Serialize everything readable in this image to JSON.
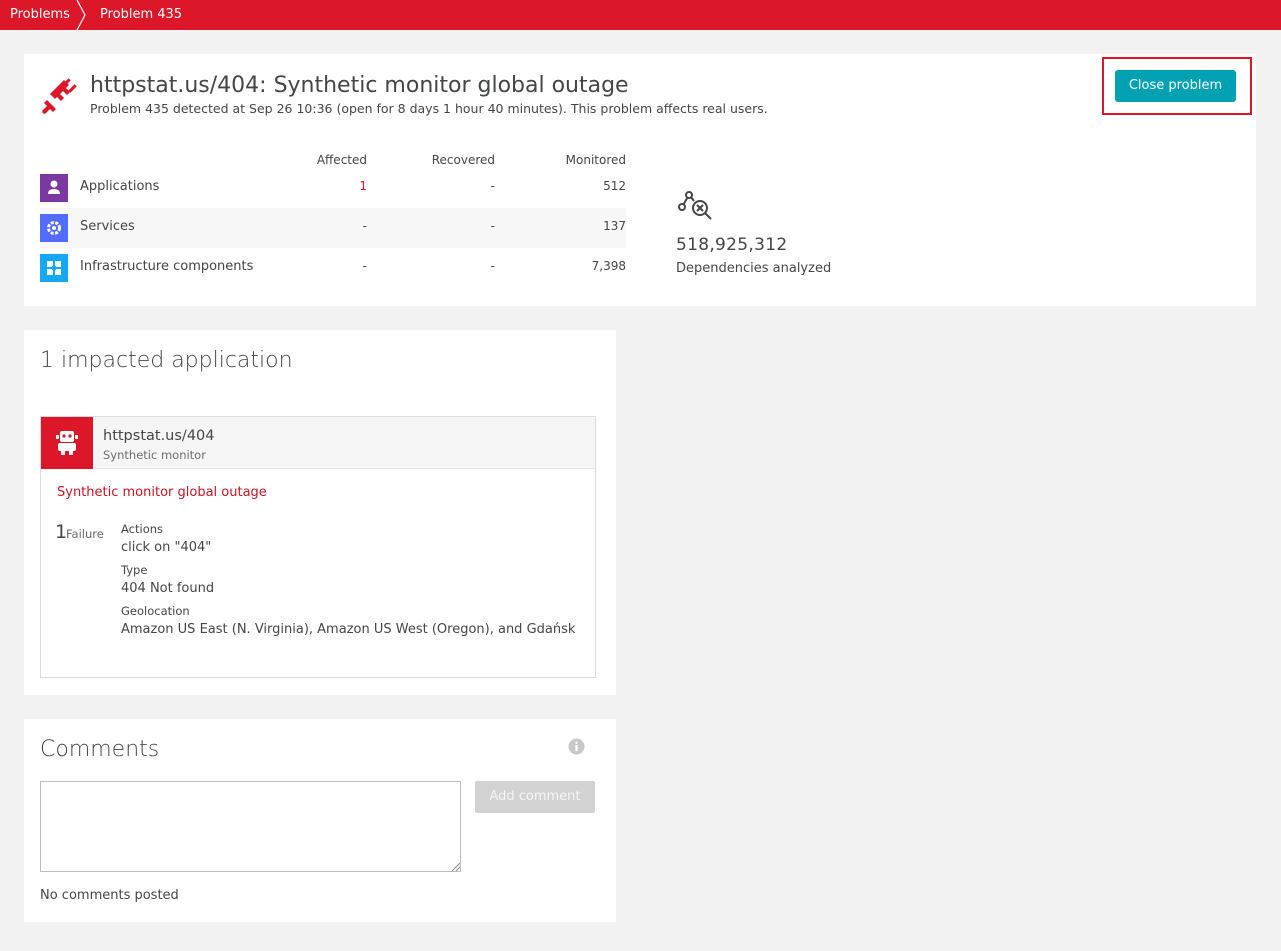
{
  "breadcrumb": {
    "items": [
      {
        "label": "Problems"
      },
      {
        "label": "Problem 435"
      }
    ]
  },
  "problem": {
    "title": "httpstat.us/404: Synthetic monitor global outage",
    "subtitle": "Problem 435 detected at Sep 26 10:36 (open for 8 days 1 hour 40 minutes). This problem affects real users.",
    "close_label": "Close problem",
    "icon": "plug-disconnected-icon"
  },
  "impact_table": {
    "headers": {
      "affected": "Affected",
      "recovered": "Recovered",
      "monitored": "Monitored"
    },
    "rows": [
      {
        "label": "Applications",
        "affected": "1",
        "recovered": "-",
        "monitored": "512",
        "icon": "application-icon",
        "color": "#7c38a1"
      },
      {
        "label": "Services",
        "affected": "-",
        "recovered": "-",
        "monitored": "137",
        "icon": "service-icon",
        "color": "#526cff"
      },
      {
        "label": "Infrastructure components",
        "affected": "-",
        "recovered": "-",
        "monitored": "7,398",
        "icon": "infrastructure-icon",
        "color": "#14a8f5"
      }
    ]
  },
  "dependencies": {
    "value": "518,925,312",
    "label": "Dependencies analyzed",
    "icon": "dependency-analysis-icon"
  },
  "impacted": {
    "title": "1 impacted application",
    "app": {
      "name": "httpstat.us/404",
      "type": "Synthetic monitor",
      "icon": "robot-icon",
      "event_title": "Synthetic monitor global outage",
      "failure_count": "1",
      "failure_label": "Failure",
      "details": [
        {
          "key": "Actions",
          "value": "click on \"404\""
        },
        {
          "key": "Type",
          "value": "404 Not found"
        },
        {
          "key": "Geolocation",
          "value": "Amazon US East (N. Virginia), Amazon US West (Oregon), and Gdańsk"
        }
      ]
    }
  },
  "comments": {
    "title": "Comments",
    "add_label": "Add comment",
    "empty_text": "No comments posted",
    "input_value": ""
  },
  "colors": {
    "brand_red": "#dc172a",
    "accent_teal": "#00a1b2",
    "disabled_gray": "#d2d2d2"
  }
}
